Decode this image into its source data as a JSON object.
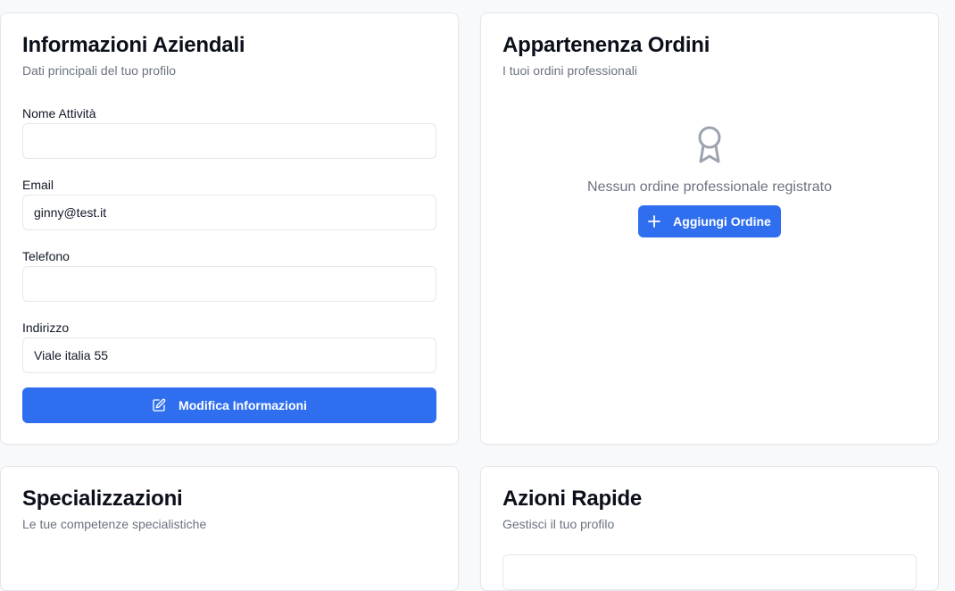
{
  "business_info": {
    "title": "Informazioni Aziendali",
    "subtitle": "Dati principali del tuo profilo",
    "fields": {
      "name": {
        "label": "Nome Attività",
        "value": ""
      },
      "email": {
        "label": "Email",
        "value": "ginny@test.it"
      },
      "phone": {
        "label": "Telefono",
        "value": ""
      },
      "address": {
        "label": "Indirizzo",
        "value": "Viale italia 55"
      }
    },
    "edit_button": {
      "label": "Modifica Informazioni",
      "icon": "edit-icon"
    }
  },
  "orders": {
    "title": "Appartenenza Ordini",
    "subtitle": "I tuoi ordini professionali",
    "empty_icon": "award-icon",
    "empty_text": "Nessun ordine professionale registrato",
    "add_button": {
      "label": "Aggiungi Ordine",
      "icon": "plus-icon"
    }
  },
  "specializations": {
    "title": "Specializzazioni",
    "subtitle": "Le tue competenze specialistiche"
  },
  "quick_actions": {
    "title": "Azioni Rapide",
    "subtitle": "Gestisci il tuo profilo"
  },
  "colors": {
    "primary": "#2f6fef",
    "muted_text": "#6b7280",
    "border": "#e5e7eb",
    "background": "#f8f9fb"
  }
}
